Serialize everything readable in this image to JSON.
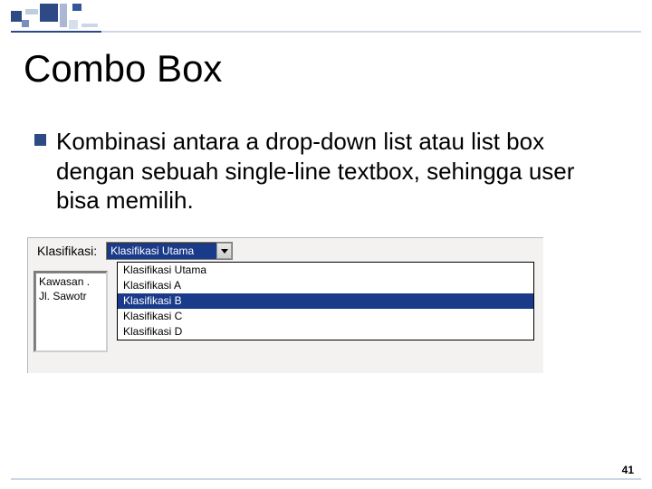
{
  "title": "Combo Box",
  "bullet": "Kombinasi antara a drop-down list atau list box dengan sebuah single-line textbox, sehingga user bisa memilih.",
  "form": {
    "label": "Klasifikasi:",
    "combo_value": "Klasifikasi Utama",
    "options": [
      "Klasifikasi Utama",
      "Klasifikasi A",
      "Klasifikasi B",
      "Klasifikasi C",
      "Klasifikasi D"
    ],
    "selected_index": 2
  },
  "listbox": {
    "items": [
      "Kawasan .",
      "Jl. Sawotr"
    ]
  },
  "page_number": "41"
}
